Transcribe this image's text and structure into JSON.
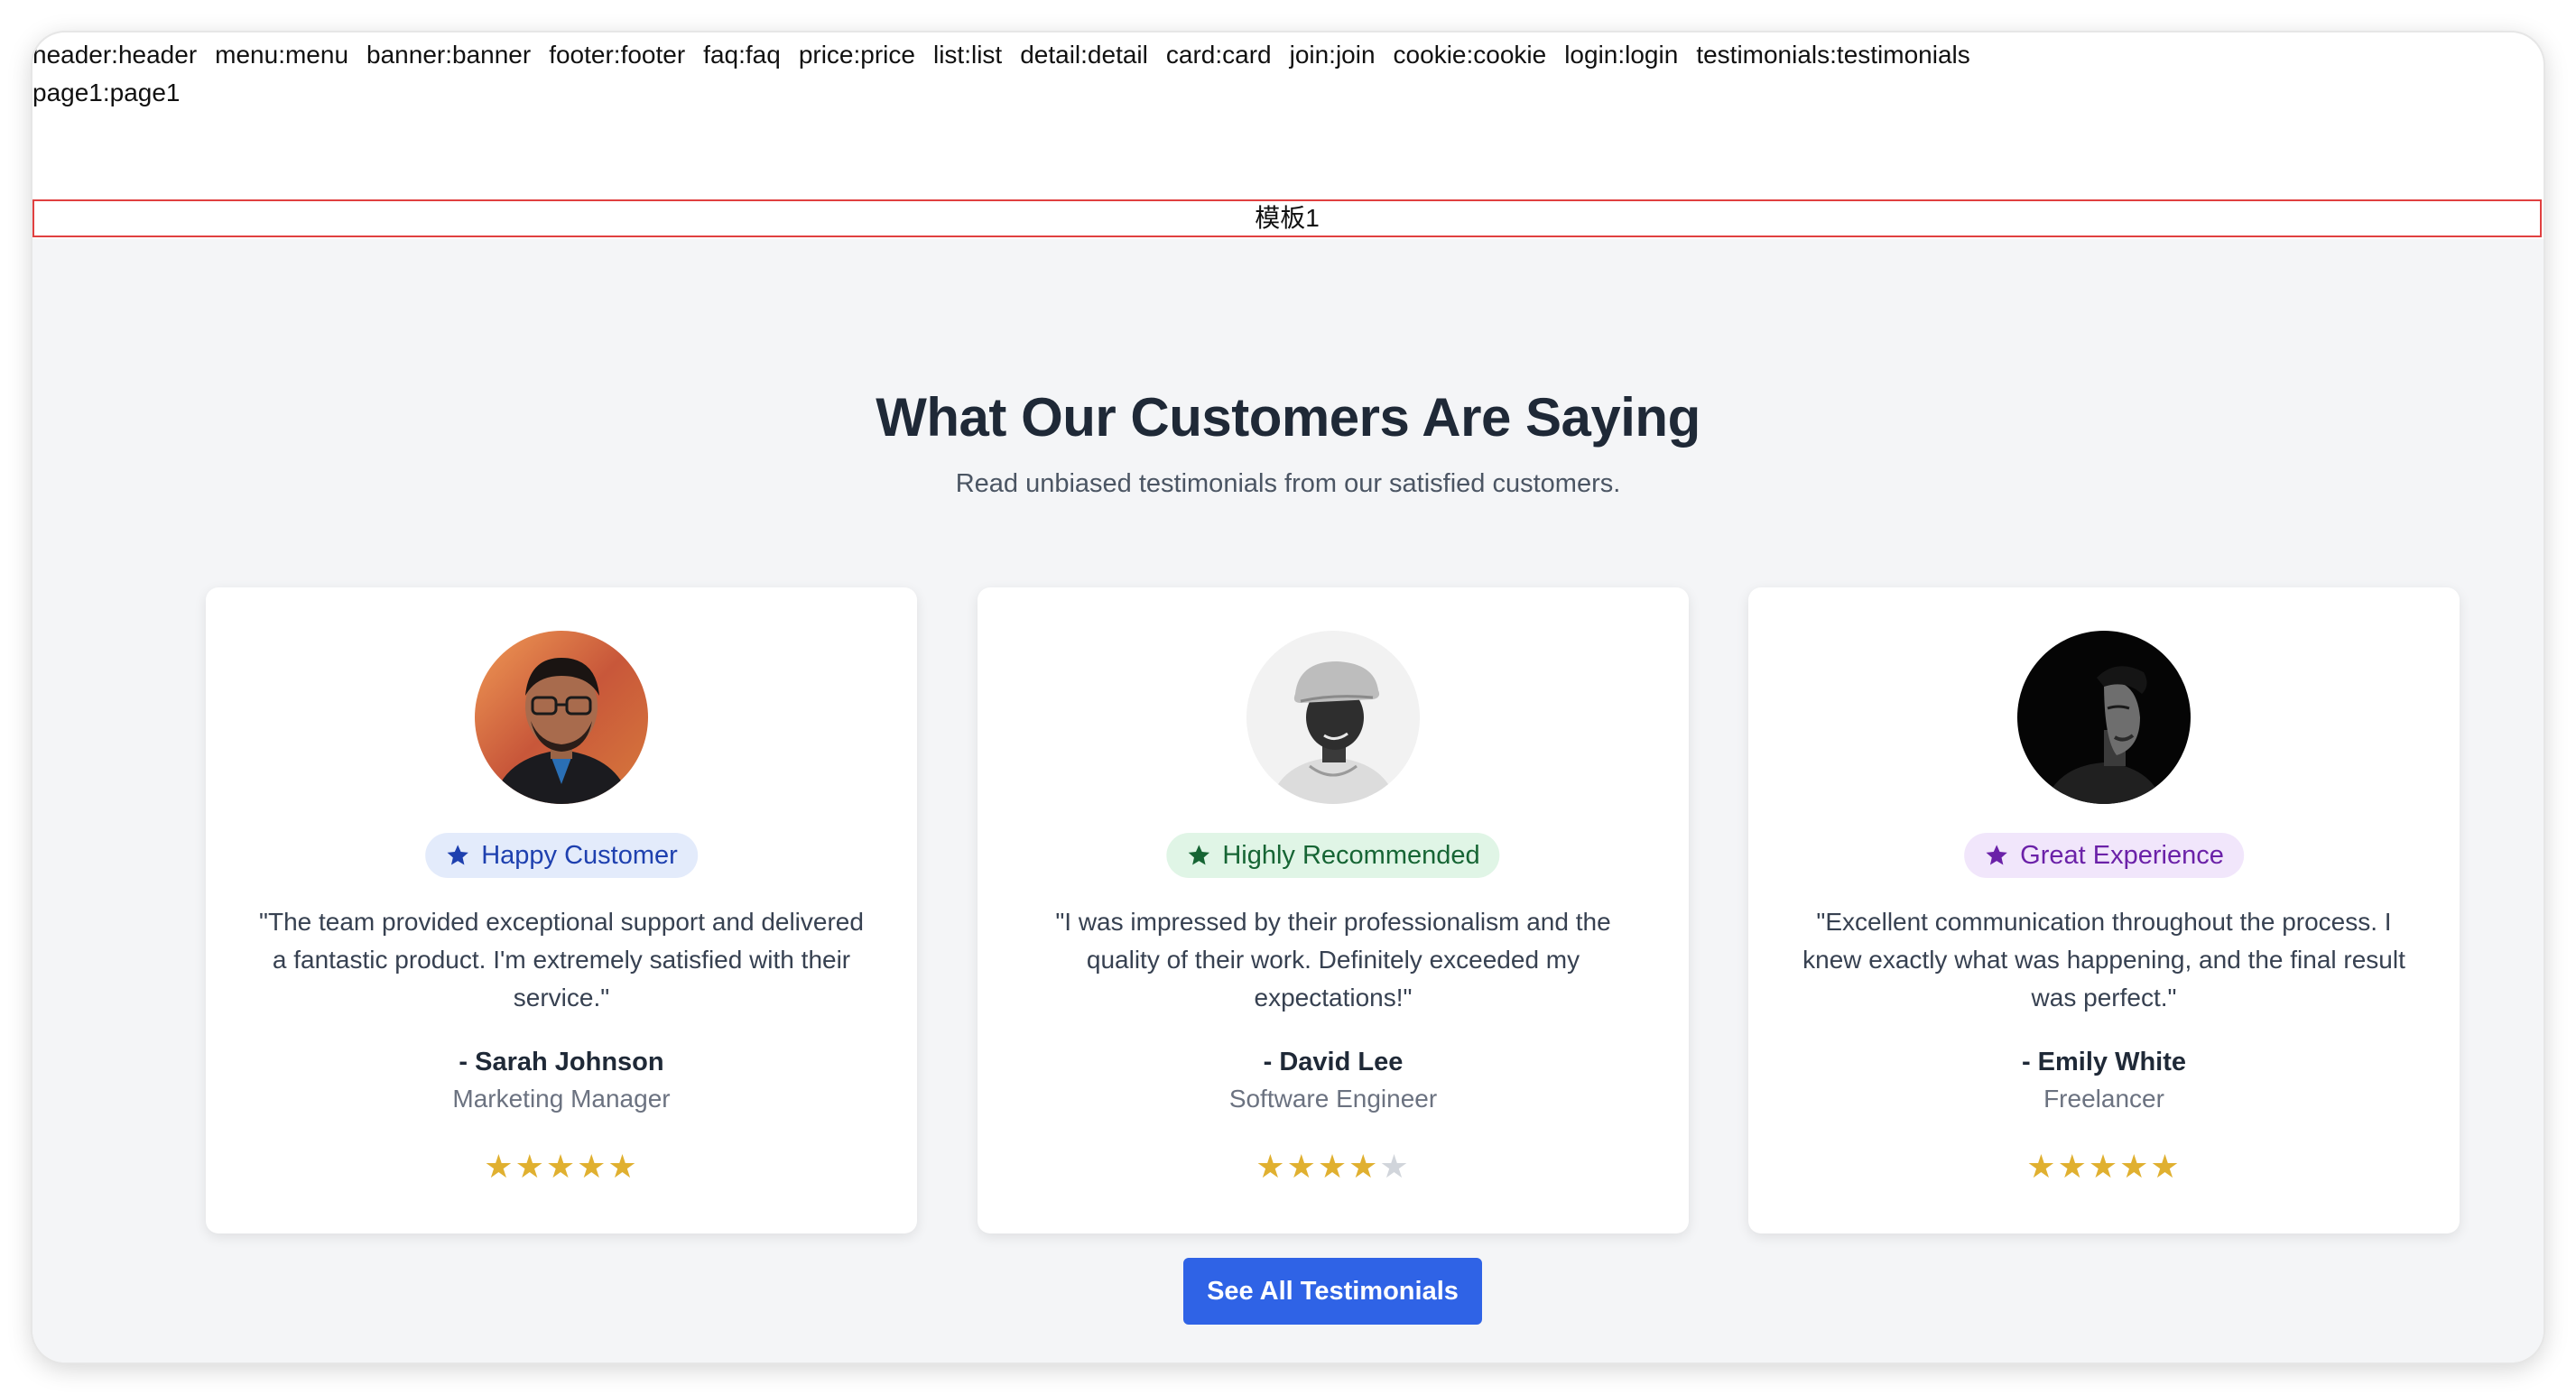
{
  "nav": {
    "links": [
      "header:header",
      "menu:menu",
      "banner:banner",
      "footer:footer",
      "faq:faq",
      "price:price",
      "list:list",
      "detail:detail",
      "card:card",
      "join:join",
      "cookie:cookie",
      "login:login",
      "testimonials:testimonials",
      "page1:page1"
    ]
  },
  "template_label": "模板1",
  "section": {
    "title": "What Our Customers Are Saying",
    "subtitle": "Read unbiased testimonials from our satisfied customers.",
    "cta_label": "See All Testimonials"
  },
  "colors": {
    "accent": "#2f63e6",
    "star_filled": "#e0b030",
    "star_empty": "#d1d5db",
    "background": "#f4f5f7"
  },
  "testimonials": [
    {
      "badge": "Happy Customer",
      "badge_icon": "star-icon",
      "badge_bg": "#e3ebfb",
      "badge_color": "#1e40af",
      "quote": "\"The team provided exceptional support and delivered a fantastic product. I'm extremely satisfied with their service.\"",
      "name": "- Sarah Johnson",
      "role": "Marketing Manager",
      "rating": 5,
      "rating_max": 5
    },
    {
      "badge": "Highly Recommended",
      "badge_icon": "star-icon",
      "badge_bg": "#e0f5e6",
      "badge_color": "#166534",
      "quote": "\"I was impressed by their professionalism and the quality of their work. Definitely exceeded my expectations!\"",
      "name": "- David Lee",
      "role": "Software Engineer",
      "rating": 4,
      "rating_max": 5
    },
    {
      "badge": "Great Experience",
      "badge_icon": "star-icon",
      "badge_bg": "#f1e6fb",
      "badge_color": "#6b21a8",
      "quote": "\"Excellent communication throughout the process. I knew exactly what was happening, and the final result was perfect.\"",
      "name": "- Emily White",
      "role": "Freelancer",
      "rating": 5,
      "rating_max": 5
    }
  ]
}
